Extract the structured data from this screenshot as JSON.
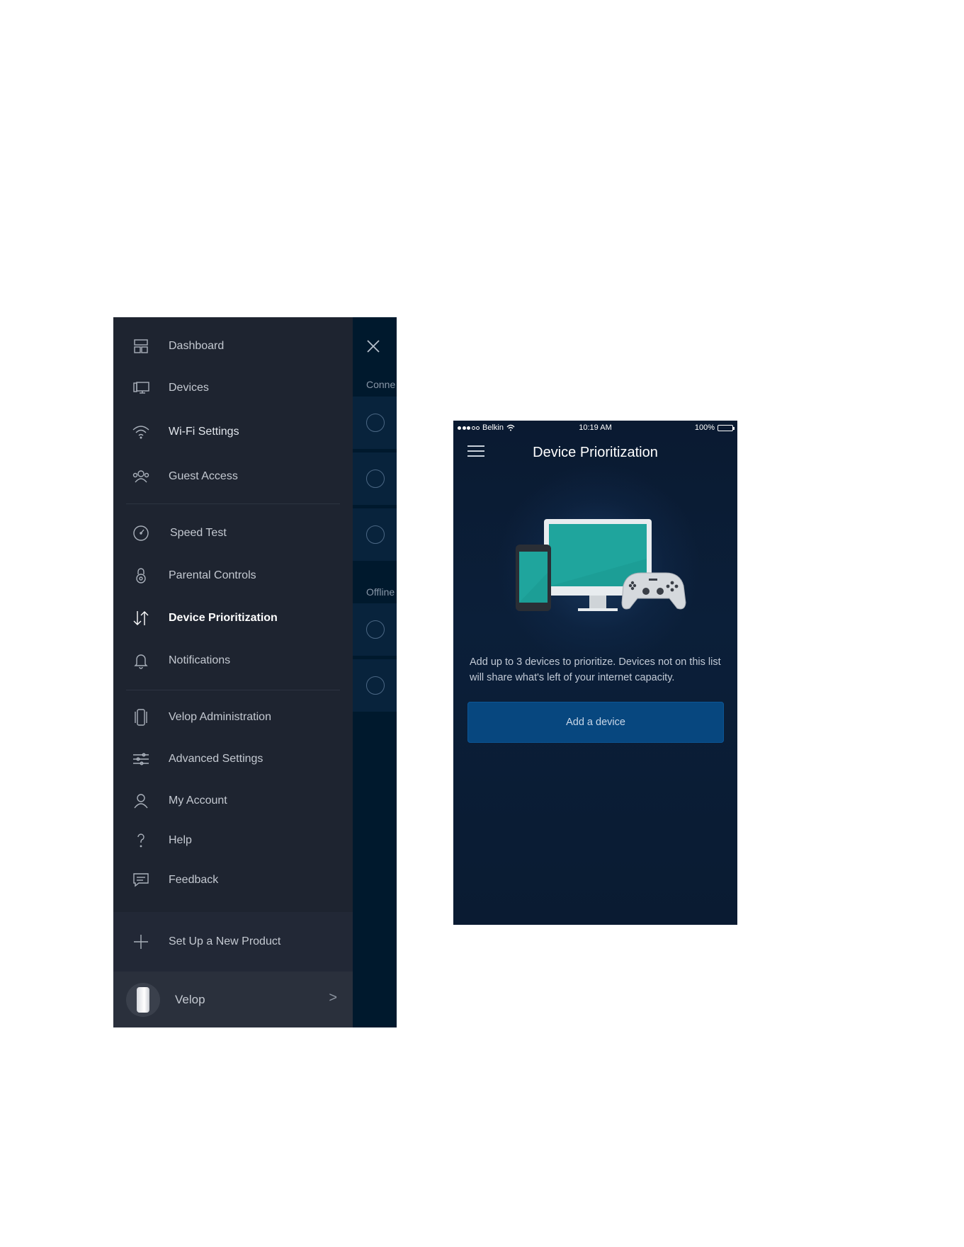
{
  "drawer": {
    "items": [
      {
        "label": "Dashboard",
        "icon": "dashboard-icon"
      },
      {
        "label": "Devices",
        "icon": "devices-icon"
      },
      {
        "label": "Wi-Fi Settings",
        "icon": "wifi-icon"
      },
      {
        "label": "Guest Access",
        "icon": "guest-access-icon"
      },
      {
        "label": "Speed Test",
        "icon": "speedometer-icon"
      },
      {
        "label": "Parental Controls",
        "icon": "lock-icon"
      },
      {
        "label": "Device Prioritization",
        "icon": "arrows-up-down-icon",
        "active": true
      },
      {
        "label": "Notifications",
        "icon": "bell-icon"
      },
      {
        "label": "Velop Administration",
        "icon": "node-icon"
      },
      {
        "label": "Advanced Settings",
        "icon": "sliders-icon"
      },
      {
        "label": "My Account",
        "icon": "user-icon"
      },
      {
        "label": "Help",
        "icon": "question-icon"
      },
      {
        "label": "Feedback",
        "icon": "chat-icon"
      }
    ],
    "setup_label": "Set Up a New Product",
    "setup_icon": "plus-icon",
    "network_name": "Velop",
    "network_chevron": ">"
  },
  "background_screen": {
    "connected_label": "Conne",
    "offline_label": "Offline"
  },
  "phone": {
    "status_bar": {
      "carrier": "Belkin",
      "time": "10:19 AM",
      "battery": "100%",
      "battery_level": 1.0
    },
    "title": "Device Prioritization",
    "description": "Add up to 3 devices to prioritize. Devices not on this list will share what's left of your internet capacity.",
    "add_button_label": "Add a device"
  },
  "colors": {
    "drawer_bg": "#1e2430",
    "screen_bg": "#0a1b32",
    "button_bg": "#07477f"
  }
}
